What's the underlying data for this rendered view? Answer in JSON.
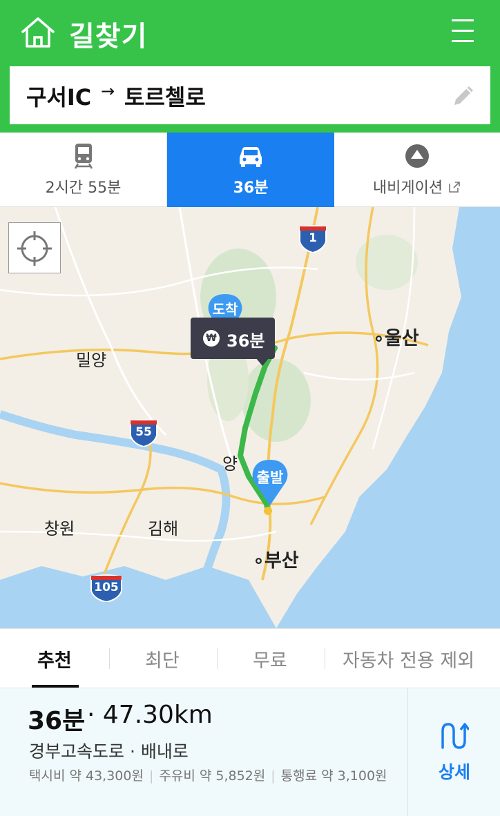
{
  "header": {
    "title": "길찾기",
    "home_icon": "home-icon",
    "menu_icon": "hamburger-menu-icon",
    "background_color": "#37c34a"
  },
  "route": {
    "origin": "구서IC",
    "arrow": "→",
    "destination": "토르첼로",
    "edit_icon": "pencil-icon"
  },
  "transport_tabs": [
    {
      "icon": "train-icon",
      "label": "2시간 55분",
      "active": false
    },
    {
      "icon": "car-icon",
      "label": "36분",
      "active": true
    },
    {
      "icon": "navigation-icon",
      "label": "내비게이션",
      "active": false
    }
  ],
  "map": {
    "locate_icon": "crosshair-icon",
    "labels": {
      "miryang": "밀양",
      "ulsan": "울산",
      "changwon": "창원",
      "gimhae": "김해",
      "busan": "부산",
      "yangsan_partial": "양"
    },
    "highway_shields": {
      "h1": "1",
      "h55": "55",
      "h105": "105"
    },
    "pins": {
      "destination": "도착",
      "origin": "출발"
    },
    "time_bubble": {
      "icon": "₩",
      "text": "36분"
    },
    "route_color": "#3cb84a",
    "sea_color": "#a9d3f2"
  },
  "route_options": {
    "recommended": "추천",
    "shortest": "최단",
    "free": "무료",
    "no_highway": "자동차 전용 제외",
    "selected": "추천"
  },
  "summary": {
    "time": "36분",
    "distance": "· 47.30km",
    "road": "경부고속도로 · 배내로",
    "taxi": "택시비 약 43,300원",
    "fuel": "주유비 약 5,852원",
    "toll": "통행료 약 3,100원",
    "detail_label": "상세",
    "detail_icon": "u-turn-route-icon"
  }
}
